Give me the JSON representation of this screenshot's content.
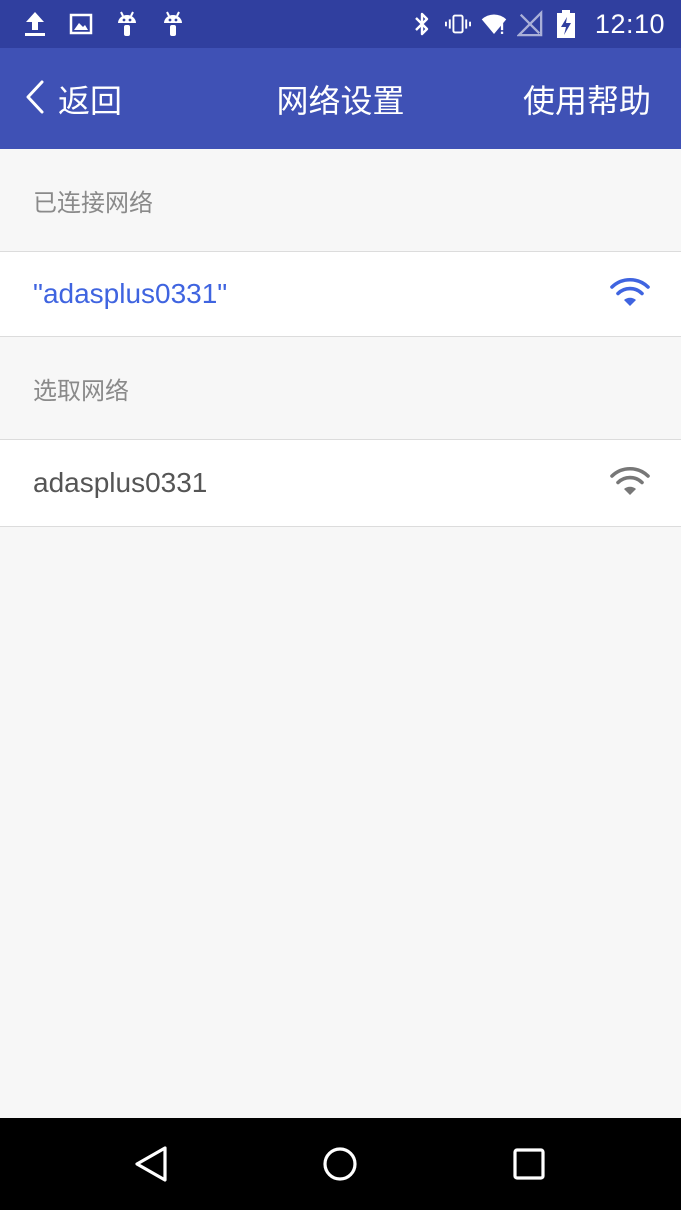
{
  "status_bar": {
    "time": "12:10",
    "left_icons": [
      "upload-icon",
      "image-icon",
      "android-icon",
      "android-icon"
    ],
    "right_icons": [
      "bluetooth-icon",
      "vibrate-icon",
      "wifi-alert-icon",
      "no-signal-icon",
      "battery-charging-icon"
    ]
  },
  "app_bar": {
    "back_label": "返回",
    "title": "网络设置",
    "help_label": "使用帮助",
    "color": "#3f51b5"
  },
  "sections": {
    "connected_header": "已连接网络",
    "available_header": "选取网络"
  },
  "networks": {
    "connected": {
      "ssid": "\"adasplus0331\"",
      "color": "#3f64e0"
    },
    "available": [
      {
        "ssid": "adasplus0331"
      }
    ]
  },
  "nav_bar": {
    "buttons": [
      "back-triangle-icon",
      "home-circle-icon",
      "recents-square-icon"
    ]
  }
}
